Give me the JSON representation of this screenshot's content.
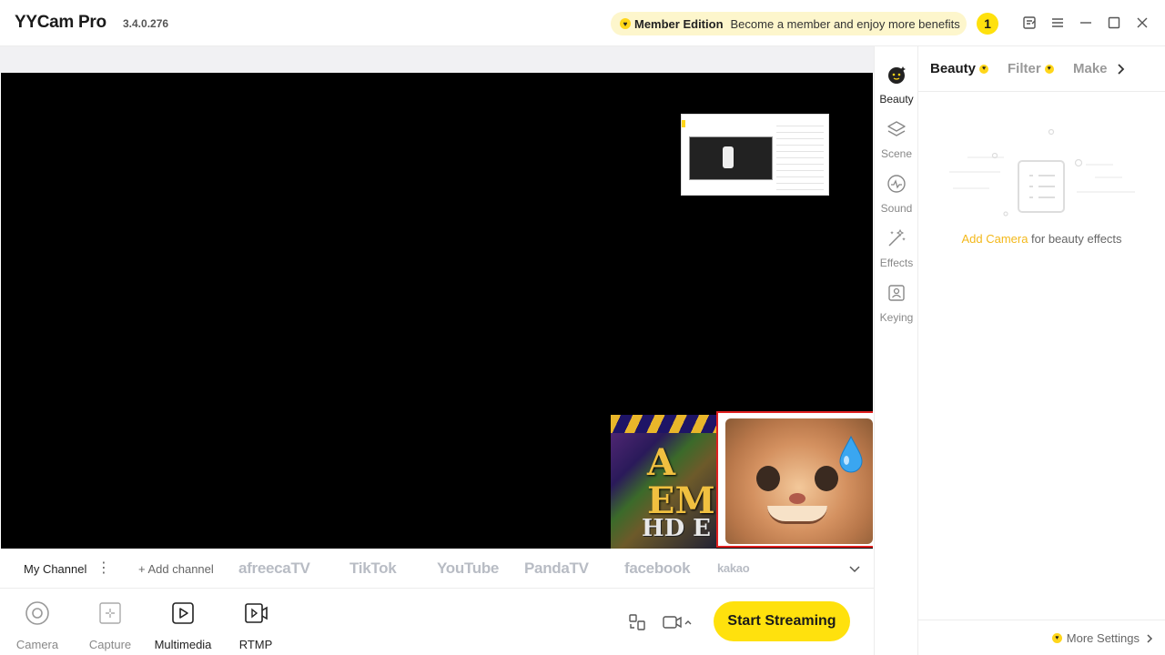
{
  "titlebar": {
    "app_name": "YYCam Pro",
    "version": "3.4.0.276",
    "member_title": "Member Edition",
    "member_subtitle": "Become a member and enjoy more benefits",
    "notification_count": "1"
  },
  "channels": {
    "my_channel": "My Channel",
    "add_channel": "+ Add channel",
    "platforms": [
      "afreecaTV",
      "TikTok",
      "YouTube",
      "PandaTV",
      "facebook",
      "kakao"
    ]
  },
  "toolbar": {
    "tools": [
      {
        "label": "Camera"
      },
      {
        "label": "Capture"
      },
      {
        "label": "Multimedia"
      },
      {
        "label": "RTMP"
      }
    ],
    "start_label": "Start Streaming"
  },
  "sidebar": {
    "items": [
      {
        "label": "Beauty"
      },
      {
        "label": "Scene"
      },
      {
        "label": "Sound"
      },
      {
        "label": "Effects"
      },
      {
        "label": "Keying"
      }
    ]
  },
  "panel": {
    "tabs": [
      "Beauty",
      "Filter",
      "Makeup"
    ],
    "empty_link": "Add Camera",
    "empty_text": " for beauty effects",
    "more_settings": "More Settings"
  },
  "preview": {
    "game_letters": "A\nEM",
    "game_hd": "HD E"
  },
  "colors": {
    "accent": "#ffe10d",
    "link": "#f3b81a",
    "highlight_border": "#e02020"
  }
}
